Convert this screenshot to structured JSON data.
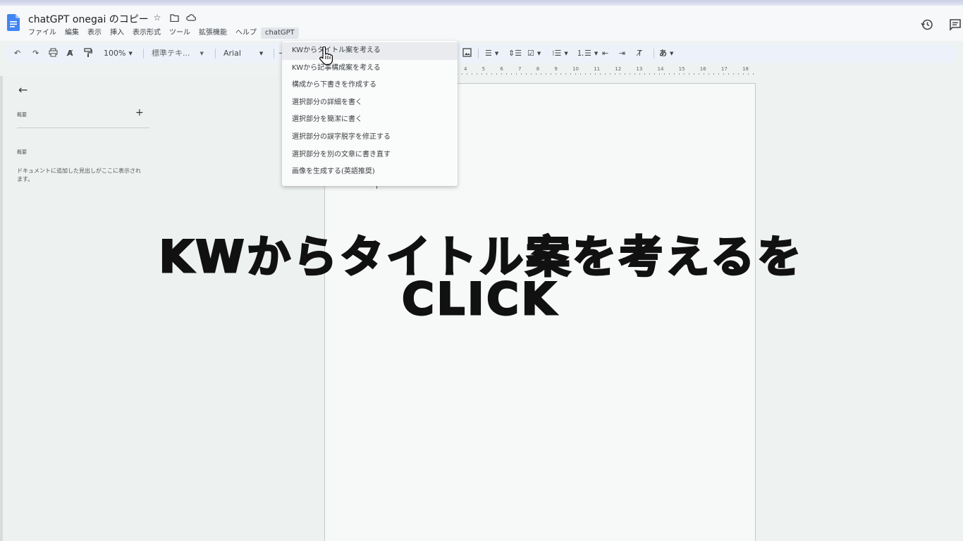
{
  "document": {
    "title": "chatGPT onegai のコピー"
  },
  "menubar": {
    "items": [
      {
        "label": "ファイル"
      },
      {
        "label": "編集"
      },
      {
        "label": "表示"
      },
      {
        "label": "挿入"
      },
      {
        "label": "表示形式"
      },
      {
        "label": "ツール"
      },
      {
        "label": "拡張機能"
      },
      {
        "label": "ヘルプ"
      },
      {
        "label": "chatGPT"
      }
    ]
  },
  "toolbar": {
    "zoom": "100%",
    "style": "標準テキ...",
    "font": "Arial"
  },
  "ruler": {
    "numbers": [
      "4",
      "5",
      "6",
      "7",
      "8",
      "9",
      "10",
      "11",
      "12",
      "13",
      "14",
      "15",
      "16",
      "17",
      "18"
    ]
  },
  "sidebar": {
    "heading": "概要",
    "heading2": "概要",
    "description": "ドキュメントに追加した見出しがここに表示されます。"
  },
  "dropdown": {
    "items": [
      {
        "label": "KWからタイトル案を考える"
      },
      {
        "label": "KWから記事構成案を考える"
      },
      {
        "label": "構成から下書きを作成する"
      },
      {
        "label": "選択部分の詳細を書く"
      },
      {
        "label": "選択部分を簡潔に書く"
      },
      {
        "label": "選択部分の誤字脱字を修正する"
      },
      {
        "label": "選択部分を別の文章に書き直す"
      },
      {
        "label": "画像を生成する(英語推奨)"
      }
    ]
  },
  "caption": {
    "line1": "KWからタイトル案を考えるを",
    "line2": "CLICK"
  },
  "colors": {
    "docs_blue": "#4285f4",
    "toolbar_bg": "#edf2fa",
    "menu_hover": "#e9ebee"
  }
}
